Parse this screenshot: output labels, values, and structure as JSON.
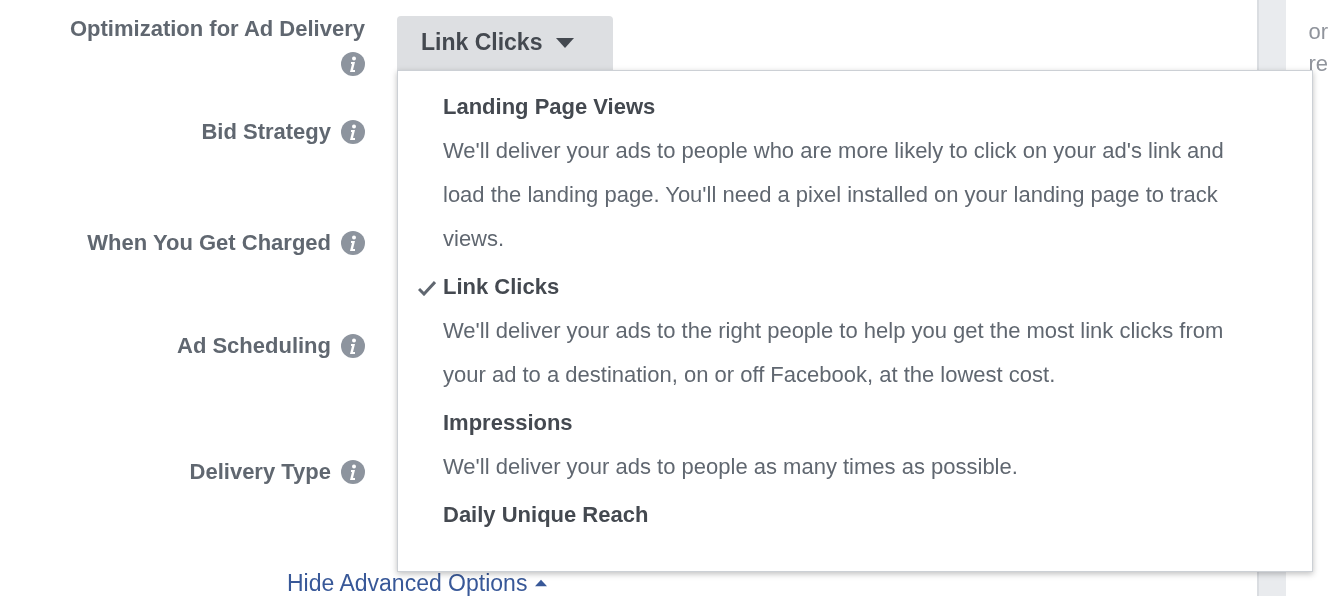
{
  "fields": [
    {
      "label": "Optimization for Ad Delivery"
    },
    {
      "label": "Bid Strategy"
    },
    {
      "label": "When You Get Charged"
    },
    {
      "label": "Ad Scheduling"
    },
    {
      "label": "Delivery Type"
    }
  ],
  "dropdown": {
    "value": "Link Clicks",
    "expanded": true,
    "options": [
      {
        "title": "Landing Page Views",
        "description": "We'll deliver your ads to people who are more likely to click on your ad's link and load the landing page. You'll need a pixel installed on your landing page to track views.",
        "selected": false
      },
      {
        "title": "Link Clicks",
        "description": "We'll deliver your ads to the right people to help you get the most link clicks from your ad to a destination, on or off Facebook, at the lowest cost.",
        "selected": true
      },
      {
        "title": "Impressions",
        "description": "We'll deliver your ads to people as many times as possible.",
        "selected": false
      },
      {
        "title": "Daily Unique Reach",
        "selected": false
      }
    ]
  },
  "advanced_link": "Hide Advanced Options",
  "side_panel": {
    "lines": [
      "or",
      "re"
    ]
  }
}
